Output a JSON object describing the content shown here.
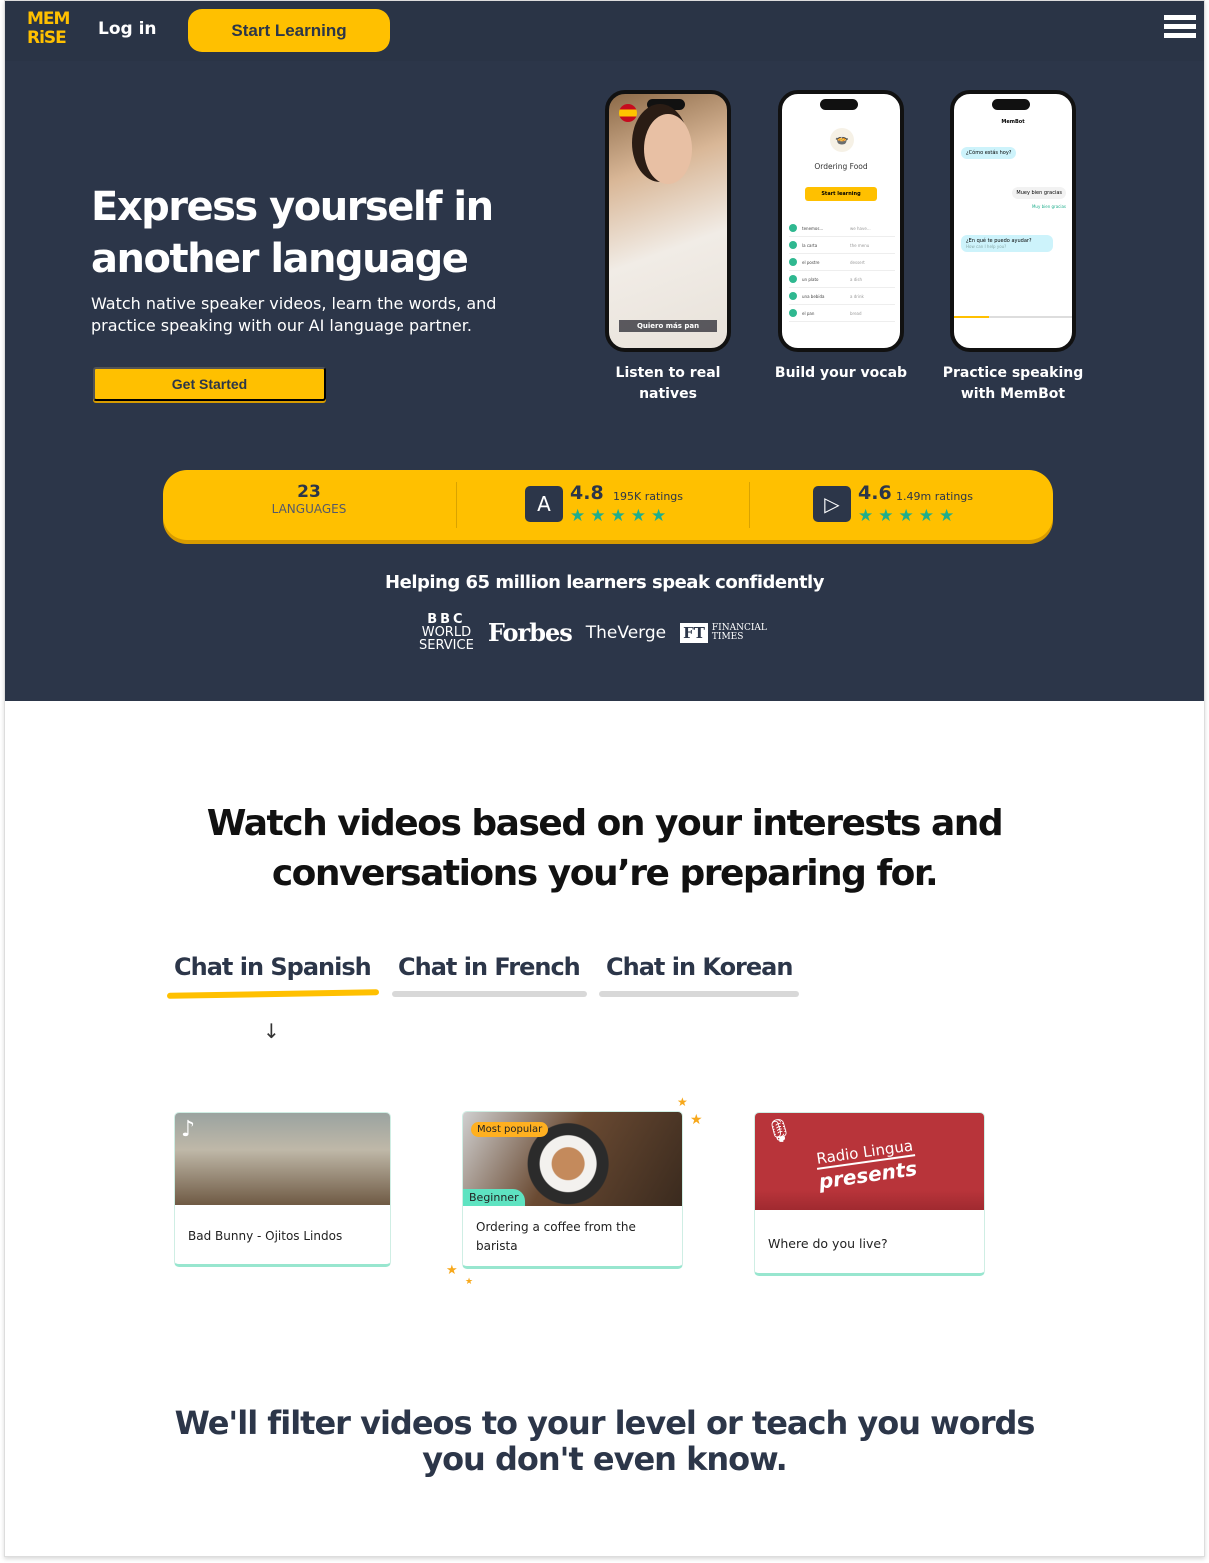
{
  "nav": {
    "logo_line1": "MEM",
    "logo_line2": "RiSE",
    "login": "Log in",
    "start": "Start Learning"
  },
  "hero": {
    "title_line1": "Express yourself in",
    "title_line2": "another language",
    "subtitle": "Watch native speaker videos, learn the words, and practice speaking with our AI language partner.",
    "cta": "Get Started"
  },
  "phones": [
    {
      "caption": "Listen to real natives",
      "subtitle_text": "Quiero más pan"
    },
    {
      "caption": "Build your vocab",
      "title": "Ordering Food",
      "button": "Start learning",
      "words": [
        [
          "tenemos...",
          "we have..."
        ],
        [
          "la carta",
          "the menu"
        ],
        [
          "el postre",
          "dessert"
        ],
        [
          "un plato",
          "a dish"
        ],
        [
          "una bebida",
          "a drink"
        ],
        [
          "el pan",
          "bread"
        ]
      ]
    },
    {
      "caption": "Practice speaking with MemBot",
      "header": "MemBot",
      "msg1": "¿Cómo estás hoy?",
      "reply": "Muey bien gracias",
      "correction": "Muy bien gracias",
      "msg2": "¿En qué te puedo ayudar?",
      "msg2_translation": "How can I help you?"
    }
  ],
  "stats": {
    "languages_count": "23",
    "languages_label": "LANGUAGES",
    "appstore_rating": "4.8",
    "appstore_count": "195K ratings",
    "play_rating": "4.6",
    "play_count": "1.49m ratings",
    "stars": "★★★★★"
  },
  "press": {
    "heading": "Helping 65 million learners speak confidently",
    "bbc": [
      "BBC",
      "WORLD",
      "SERVICE"
    ],
    "forbes": "Forbes",
    "verge": "TheVerge",
    "ft_mark": "FT",
    "ft_name": [
      "FINANCIAL",
      "TIMES"
    ]
  },
  "section": {
    "heading_line1": "Watch videos based on your interests and",
    "heading_line2": "conversations you’re preparing for.",
    "tabs": [
      "Chat in Spanish",
      "Chat in French",
      "Chat in Korean"
    ],
    "active_tab": 0
  },
  "cards": [
    {
      "title": "Bad Bunny - Ojitos Lindos"
    },
    {
      "title": "Ordering a coffee from the barista",
      "badge_top": "Most popular",
      "badge_level": "Beginner"
    },
    {
      "title": "Where do you live?",
      "brand1": "Radio Lingua",
      "brand2": "presents"
    }
  ],
  "footer_heading": {
    "line1": "We'll filter videos to your level or teach you words",
    "line2": "you don't even know."
  },
  "colors": {
    "navy": "#2c3649",
    "yellow": "#ffc000",
    "teal": "#1fae8c"
  }
}
